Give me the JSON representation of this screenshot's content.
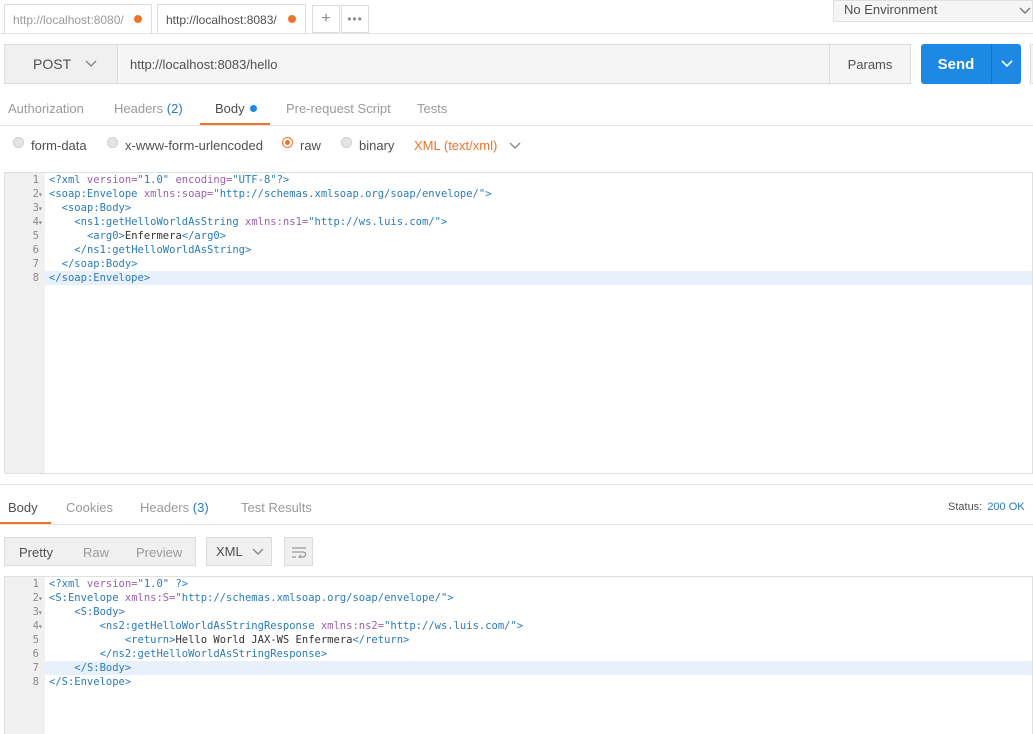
{
  "tabs": [
    {
      "url": "http://localhost:8080/"
    },
    {
      "url": "http://localhost:8083/"
    }
  ],
  "environment": {
    "label": "No Environment"
  },
  "request": {
    "method": "POST",
    "url": "http://localhost:8083/hello",
    "params_label": "Params",
    "send_label": "Send",
    "subtabs": [
      {
        "label": "Authorization"
      },
      {
        "label": "Headers",
        "count": "(2)"
      },
      {
        "label": "Body"
      },
      {
        "label": "Pre-request Script"
      },
      {
        "label": "Tests"
      }
    ],
    "body_modes": [
      "form-data",
      "x-www-form-urlencoded",
      "raw",
      "binary"
    ],
    "content_type": "XML (text/xml)",
    "code": [
      {
        "n": "1",
        "fold": false,
        "html": "&lt;?xml version=\"1.0\" encoding=\"UTF-8\"?&gt;"
      },
      {
        "n": "2",
        "fold": true,
        "html": "&lt;soap:Envelope xmlns:soap=\"http://schemas.xmlsoap.org/soap/envelope/\"&gt;"
      },
      {
        "n": "3",
        "fold": true,
        "html": "  &lt;soap:Body&gt;"
      },
      {
        "n": "4",
        "fold": true,
        "html": "    &lt;ns1:getHelloWorldAsString xmlns:ns1=\"http://ws.luis.com/\"&gt;"
      },
      {
        "n": "5",
        "fold": false,
        "html": "      &lt;arg0&gt;Enfermera&lt;/arg0&gt;"
      },
      {
        "n": "6",
        "fold": false,
        "html": "    &lt;/ns1:getHelloWorldAsString&gt;"
      },
      {
        "n": "7",
        "fold": false,
        "html": "  &lt;/soap:Body&gt;"
      },
      {
        "n": "8",
        "fold": false,
        "html": "&lt;/soap:Envelope&gt;"
      }
    ]
  },
  "response": {
    "tabs": [
      {
        "label": "Body"
      },
      {
        "label": "Cookies"
      },
      {
        "label": "Headers",
        "count": "(3)"
      },
      {
        "label": "Test Results"
      }
    ],
    "status_label": "Status:",
    "status_value": "200 OK",
    "formats": [
      "Pretty",
      "Raw",
      "Preview"
    ],
    "language": "XML",
    "code": [
      {
        "n": "1",
        "fold": false,
        "text": "<?xml version=\"1.0\" ?>"
      },
      {
        "n": "2",
        "fold": true,
        "text": "<S:Envelope xmlns:S=\"http://schemas.xmlsoap.org/soap/envelope/\">"
      },
      {
        "n": "3",
        "fold": true,
        "text": "    <S:Body>"
      },
      {
        "n": "4",
        "fold": true,
        "text": "        <ns2:getHelloWorldAsStringResponse xmlns:ns2=\"http://ws.luis.com/\">"
      },
      {
        "n": "5",
        "fold": false,
        "text": "            <return>Hello World JAX-WS Enfermera</return>"
      },
      {
        "n": "6",
        "fold": false,
        "text": "        </ns2:getHelloWorldAsStringResponse>"
      },
      {
        "n": "7",
        "fold": false,
        "text": "    </S:Body>"
      },
      {
        "n": "8",
        "fold": false,
        "text": "</S:Envelope>"
      }
    ]
  },
  "colors": {
    "accent": "#f0732b",
    "send": "#1e88e5",
    "status": "#2a7bbd"
  }
}
